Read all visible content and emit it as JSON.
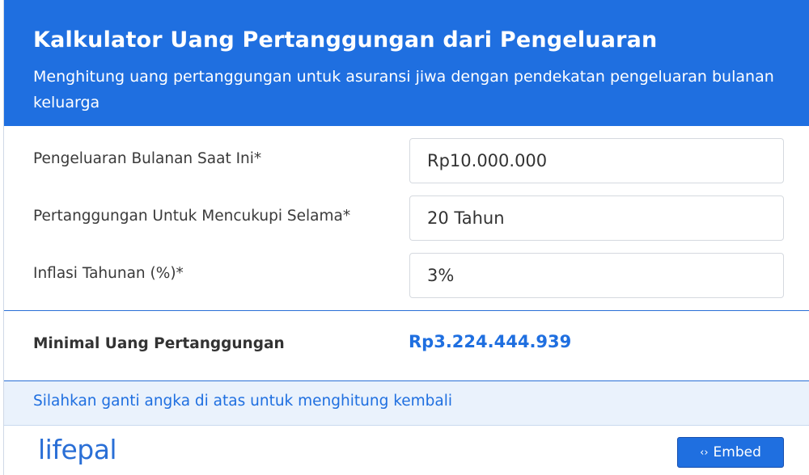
{
  "header": {
    "title": "Kalkulator Uang Pertanggungan dari Pengeluaran",
    "subtitle": "Menghitung uang pertanggungan untuk asuransi jiwa dengan pendekatan pengeluaran bulanan keluarga"
  },
  "form": {
    "monthly_expense": {
      "label": "Pengeluaran Bulanan Saat Ini*",
      "value": "Rp10.000.000"
    },
    "coverage_duration": {
      "label": "Pertanggungan Untuk Mencukupi Selama*",
      "value": "20 Tahun"
    },
    "annual_inflation": {
      "label": "Inflasi Tahunan (%)*",
      "value": "3%"
    }
  },
  "result": {
    "label": "Minimal Uang Pertanggungan",
    "value": "Rp3.224.444.939"
  },
  "note": "Silahkan ganti angka di atas untuk menghitung kembali",
  "footer": {
    "logo": "lifepal",
    "embed_icon": "‹›",
    "embed_label": "Embed"
  },
  "colors": {
    "brand_blue": "#1f6fe0",
    "note_bg": "#eaf2fc"
  },
  "icons": {
    "embed": "code-icon"
  }
}
